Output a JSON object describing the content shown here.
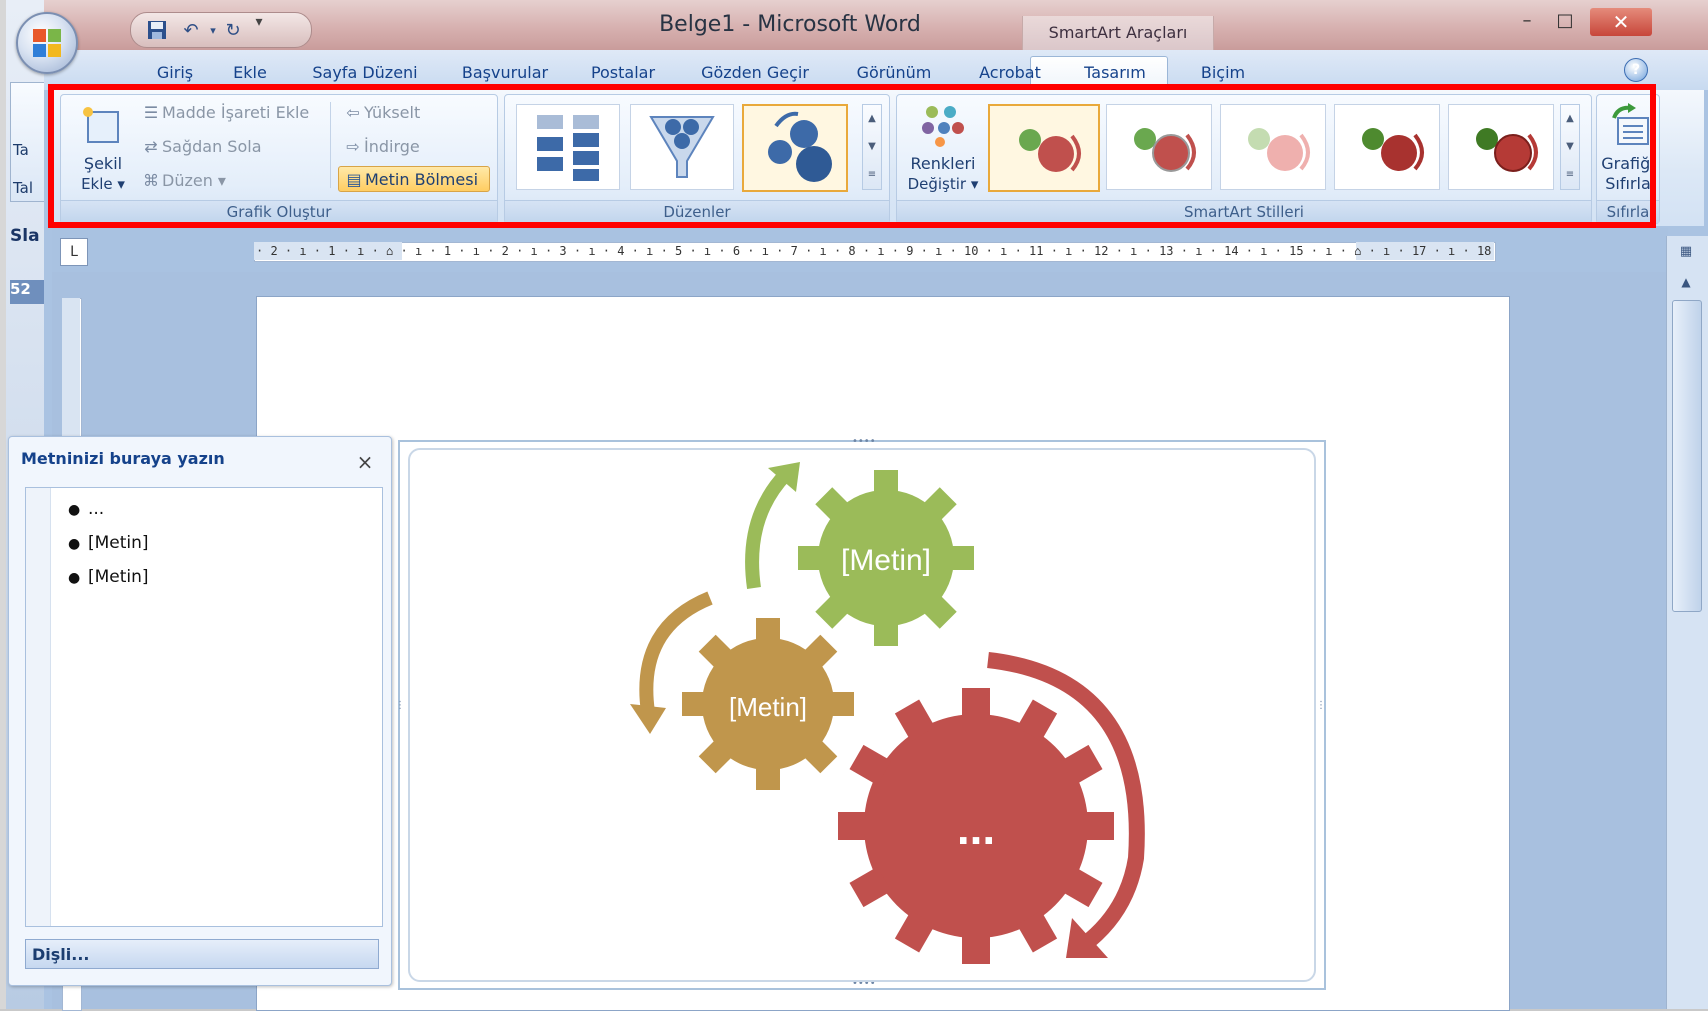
{
  "window": {
    "title": "Belge1 - Microsoft Word",
    "tools_label": "SmartArt Araçları",
    "min_glyph": "–",
    "max_glyph": "□",
    "close_glyph": "✕"
  },
  "qat": {
    "save_icon": "save-icon",
    "undo_icon": "undo-icon",
    "redo_icon": "redo-icon",
    "customize_glyph": "▾"
  },
  "tabs": [
    "Giriş",
    "Ekle",
    "Sayfa Düzeni",
    "Başvurular",
    "Postalar",
    "Gözden Geçir",
    "Görünüm",
    "Acrobat",
    "Tasarım",
    "Biçim"
  ],
  "active_tab": "Tasarım",
  "ribbon": {
    "grafik_olustur": {
      "label": "Grafik Oluştur",
      "sekil_ekle_line1": "Şekil",
      "sekil_ekle_line2": "Ekle ▾",
      "madde_isareti_ekle": "Madde İşareti Ekle",
      "sagdan_sola": "Sağdan Sola",
      "duzen": "Düzen ▾",
      "yukselt": "Yükselt",
      "indirge": "İndirge",
      "metin_bolmesi": "Metin Bölmesi"
    },
    "duzenler": {
      "label": "Düzenler",
      "layouts": [
        "vertical-list-layout",
        "funnel-layout",
        "gear-layout"
      ],
      "selected_index": 2
    },
    "renkleri_degistir_line1": "Renkleri",
    "renkleri_degistir_line2": "Değiştir ▾",
    "smartart_stilleri": {
      "label": "SmartArt Stilleri",
      "styles": [
        "style-flat",
        "style-subtle",
        "style-light",
        "style-moderate",
        "style-intense"
      ],
      "selected_index": 0
    },
    "sifirla": {
      "label": "Sıfırla",
      "button_line1": "Grafiği",
      "button_line2": "Sıfırla"
    }
  },
  "backdrop": {
    "tab_stub": "Ta",
    "tab_stub2": "Tal",
    "slides_stub": "Sla",
    "number_stub": "52"
  },
  "ruler": {
    "corner_glyph": "L",
    "ticks": "· 2 · ı · 1 · ı · ⌂ · ı · 1 · ı · 2 · ı · 3 · ı · 4 · ı · 5 · ı · 6 · ı · 7 · ı · 8 · ı · 9 · ı · 10 · ı · 11 · ı · 12 · ı · 13 · ı · 14 · ı · 15 · ı · ⌂ · ı · 17 · ı · 18 ·"
  },
  "text_pane": {
    "title": "Metninizi buraya yazın",
    "close_glyph": "×",
    "items": [
      "...",
      "[Metin]",
      "[Metin]"
    ],
    "bullet": "●",
    "link": "Dişli..."
  },
  "smartart": {
    "gear_green_text": "[Metin]",
    "gear_gold_text": "[Metin]",
    "gear_red_text": "...",
    "colors": {
      "green": "#9bbb59",
      "gold": "#c0964c",
      "red": "#c0504d"
    }
  },
  "colors": {
    "accent_frame": "#ff0000",
    "tab_text": "#15428b"
  }
}
